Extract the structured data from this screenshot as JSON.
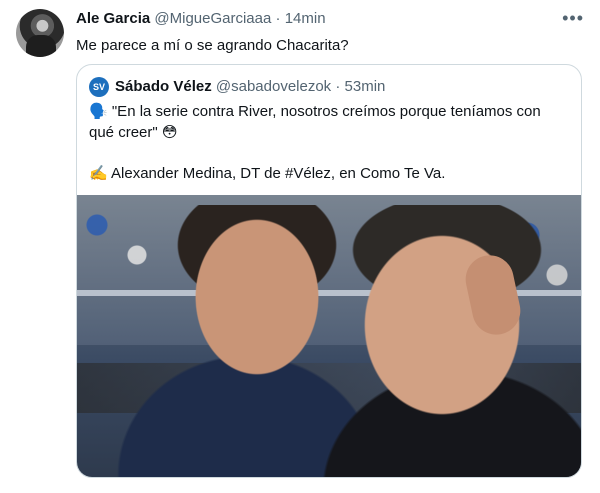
{
  "tweet": {
    "author_name": "Ale Garcia",
    "handle": "@MigueGarciaaa",
    "separator": "·",
    "time": "14min",
    "text": "Me parece a mí o se agrando Chacarita?",
    "more_icon": "more-horizontal-icon"
  },
  "quoted": {
    "author_name": "Sábado Vélez",
    "handle": "@sabadovelezok",
    "separator": "·",
    "time": "53min",
    "line1_emoji": "🗣️",
    "line1": "\"En la serie contra River, nosotros creímos porque teníamos con qué creer\"",
    "line1_end_emoji": "😳",
    "line2_emoji": "✍️",
    "line2": "Alexander Medina, DT de #Vélez, en Como Te Va."
  },
  "colors": {
    "text": "#0f1419",
    "muted": "#536471",
    "border": "#cfd9de",
    "quoted_avatar": "#1d6fbd"
  }
}
